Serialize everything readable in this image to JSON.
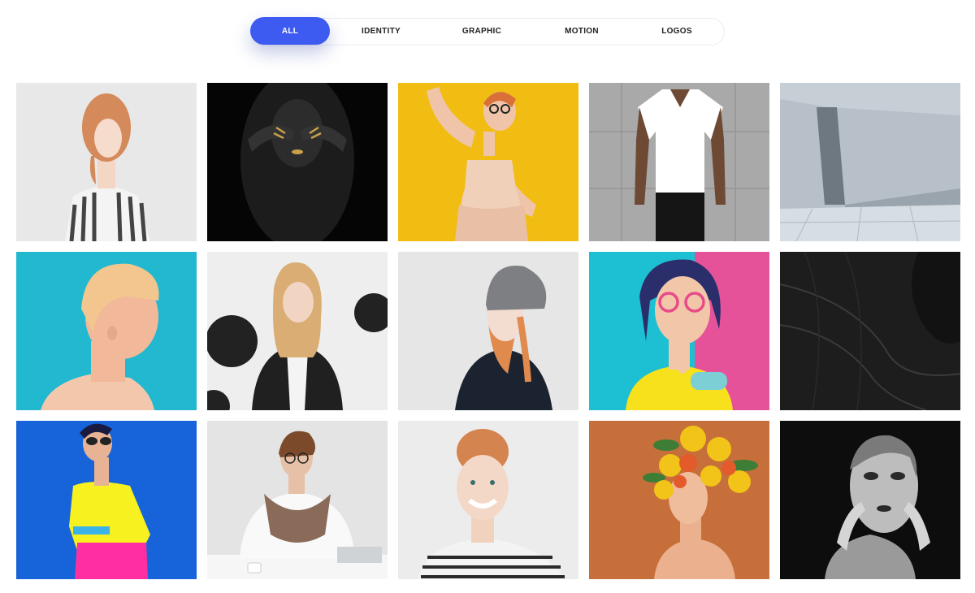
{
  "filters": {
    "items": [
      {
        "label": "ALL",
        "active": true
      },
      {
        "label": "IDENTITY",
        "active": false
      },
      {
        "label": "GRAPHIC",
        "active": false
      },
      {
        "label": "MOTION",
        "active": false
      },
      {
        "label": "LOGOS",
        "active": false
      }
    ],
    "active_color": "#3d5af1"
  },
  "gallery": {
    "items": [
      {
        "icon": "woman-striped-shirt-photo",
        "bg": "#e8e8e8",
        "accent": "#d48a5a"
      },
      {
        "icon": "black-painted-woman-photo",
        "bg": "#050505",
        "accent": "#c9a24a"
      },
      {
        "icon": "woman-yellow-background-photo",
        "bg": "#f2bd12",
        "accent": "#f0d0b8"
      },
      {
        "icon": "man-white-tshirt-photo",
        "bg": "#a9a9a9",
        "accent": "#ffffff"
      },
      {
        "icon": "concrete-room-photo",
        "bg": "#b7c0c8",
        "accent": "#6e7880"
      },
      {
        "icon": "short-hair-profile-photo",
        "bg": "#22b8cf",
        "accent": "#f1b89a"
      },
      {
        "icon": "woman-balloons-photo",
        "bg": "#eeeeee",
        "accent": "#222222"
      },
      {
        "icon": "woman-beanie-photo",
        "bg": "#e6e6e6",
        "accent": "#7d7f82"
      },
      {
        "icon": "woman-pink-glasses-photo",
        "bg": "#1dbfd3",
        "accent": "#e84b8a"
      },
      {
        "icon": "dark-architecture-photo",
        "bg": "#121212",
        "accent": "#3a3a3a"
      },
      {
        "icon": "woman-blue-background-photo",
        "bg": "#1763d9",
        "accent": "#f7f21f"
      },
      {
        "icon": "woman-laptop-scarf-photo",
        "bg": "#e4e4e4",
        "accent": "#8a6b5a"
      },
      {
        "icon": "redhead-smiling-photo",
        "bg": "#ececec",
        "accent": "#d4854f"
      },
      {
        "icon": "woman-flower-crown-photo",
        "bg": "#c66f3a",
        "accent": "#f2c318"
      },
      {
        "icon": "silver-painted-face-photo",
        "bg": "#0d0d0d",
        "accent": "#bdbdbd"
      }
    ]
  }
}
